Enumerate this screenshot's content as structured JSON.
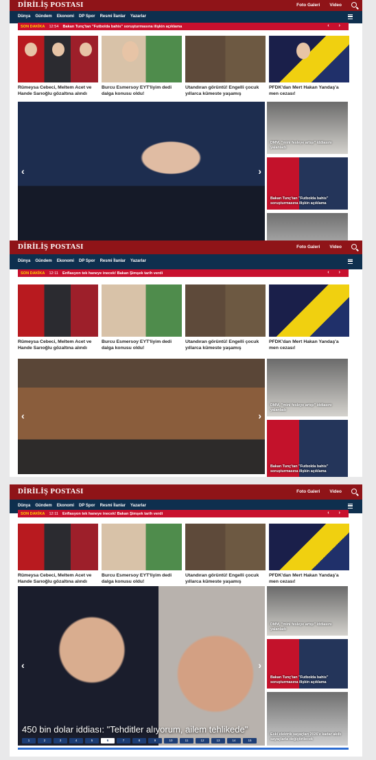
{
  "brand": "DİRİLİŞ POSTASI",
  "top_links": [
    "Foto Galeri",
    "Video"
  ],
  "nav": [
    "Dünya",
    "Gündem",
    "Ekonomi",
    "DP Spor",
    "Resmi İlanlar",
    "Yazarlar"
  ],
  "breaking_label": "SON DAKİKA",
  "frames": [
    {
      "breaking_time": "12:54",
      "breaking_text": "Bakan Tunç'tan \"Futbolda bahis\" soruşturmasına ilişkin açıklama"
    },
    {
      "breaking_time": "12:11",
      "breaking_text": "Enflasyon tek haneye inecek! Bakan Şimşek tarih verdi"
    },
    {
      "breaking_time": "12:11",
      "breaking_text": "Enflasyon tek haneye inecek! Bakan Şimşek tarih verdi",
      "hero_caption": "450 bin dolar iddiası: \"Tehditler alıyorum, ailem tehlikede\""
    }
  ],
  "cards": [
    {
      "title": "Rümeysa Cebeci, Meltem Acet ve Hande Sarıoğlu gözaltına alındı"
    },
    {
      "title": "Burcu Esmersoy EYT'liyim dedi dalga konusu oldu!"
    },
    {
      "title": "Utandıran görüntü! Engelli çocuk yıllarca kümeste yaşamış"
    },
    {
      "title": "PFDK'dan Mert Hakan Yandaş'a men cezası!"
    }
  ],
  "side_items": [
    {
      "caption": "DMM, \"mini fesleye artışı\" iddiasını yalanladı"
    },
    {
      "caption": "Bakan Tunç'tan \"Futbolda bahis\" soruşturmasına ilişkin açıklama"
    },
    {
      "caption": "Eski elektrik sayaçları 2026'e kadar akıllı sayaçlarla değiştirilecek"
    }
  ],
  "pager": [
    "1",
    "2",
    "3",
    "4",
    "5",
    "6",
    "7",
    "8",
    "9",
    "10",
    "11",
    "12",
    "13",
    "14",
    "15"
  ],
  "pager_active": 6
}
